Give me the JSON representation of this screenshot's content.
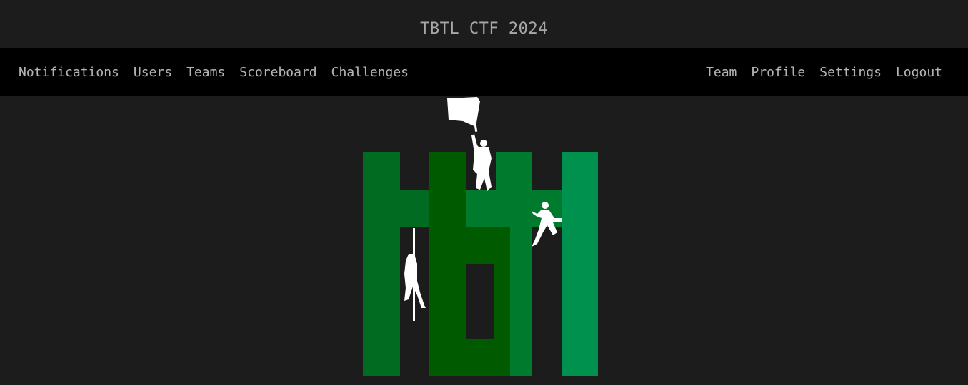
{
  "header": {
    "title": "TBTL CTF 2024"
  },
  "nav": {
    "left": [
      {
        "label": "Notifications"
      },
      {
        "label": "Users"
      },
      {
        "label": "Teams"
      },
      {
        "label": "Scoreboard"
      },
      {
        "label": "Challenges"
      }
    ],
    "right": [
      {
        "label": "Team"
      },
      {
        "label": "Profile"
      },
      {
        "label": "Settings"
      },
      {
        "label": "Logout"
      }
    ]
  },
  "logo": {
    "colors": {
      "letter_t1": "#006b21",
      "letter_b": "#005a00",
      "letter_t2": "#007b2e",
      "letter_l": "#00914f",
      "figures": "#ffffff"
    }
  }
}
